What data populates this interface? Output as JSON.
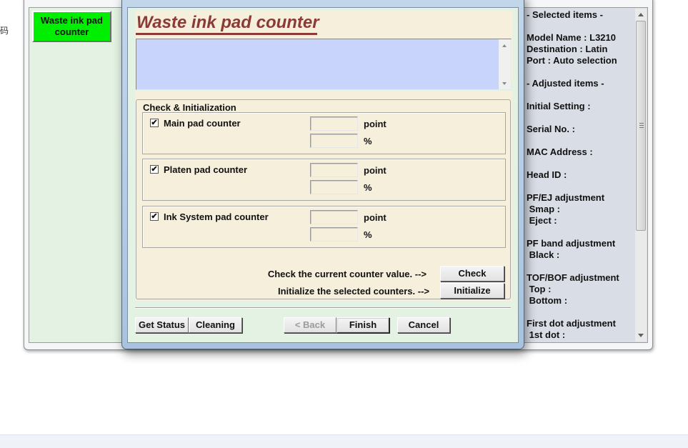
{
  "background": {
    "side_text": "码"
  },
  "back_window": {
    "menu_button": "Waste ink pad\ncounter",
    "menu_button_color": "#00ee00",
    "info_panel": {
      "lines": [
        "- Selected items -",
        "",
        "Model Name : L3210",
        "Destination : Latin",
        "Port : Auto selection",
        "",
        "- Adjusted items -",
        "",
        "Initial Setting :",
        "",
        "Serial No. :",
        "",
        "MAC Address :",
        "",
        "Head ID :",
        "",
        "PF/EJ adjustment",
        " Smap :",
        " Eject :",
        "",
        "PF band adjustment",
        " Black :",
        "",
        "TOF/BOF adjustment",
        " Top :",
        " Bottom :",
        "",
        "First dot adjustment",
        " 1st dot :"
      ]
    }
  },
  "dialog": {
    "title": "Waste ink pad counter",
    "title_color": "#8b3a36",
    "message": "",
    "group_label": "Check & Initialization",
    "counters": [
      {
        "label": "Main pad counter",
        "checked": true,
        "point_value": "",
        "percent_value": "",
        "point_unit": "point",
        "percent_unit": "%"
      },
      {
        "label": "Platen pad counter",
        "checked": true,
        "point_value": "",
        "percent_value": "",
        "point_unit": "point",
        "percent_unit": "%"
      },
      {
        "label": "Ink System pad counter",
        "checked": true,
        "point_value": "",
        "percent_value": "",
        "point_unit": "point",
        "percent_unit": "%"
      }
    ],
    "check_prompt": "Check the current counter value. -->",
    "check_button": "Check",
    "init_prompt": "Initialize the selected counters. -->",
    "init_button": "Initialize",
    "footer": {
      "get_status": "Get Status",
      "cleaning": "Cleaning",
      "back": "< Back",
      "back_disabled": true,
      "finish": "Finish",
      "cancel": "Cancel"
    }
  }
}
